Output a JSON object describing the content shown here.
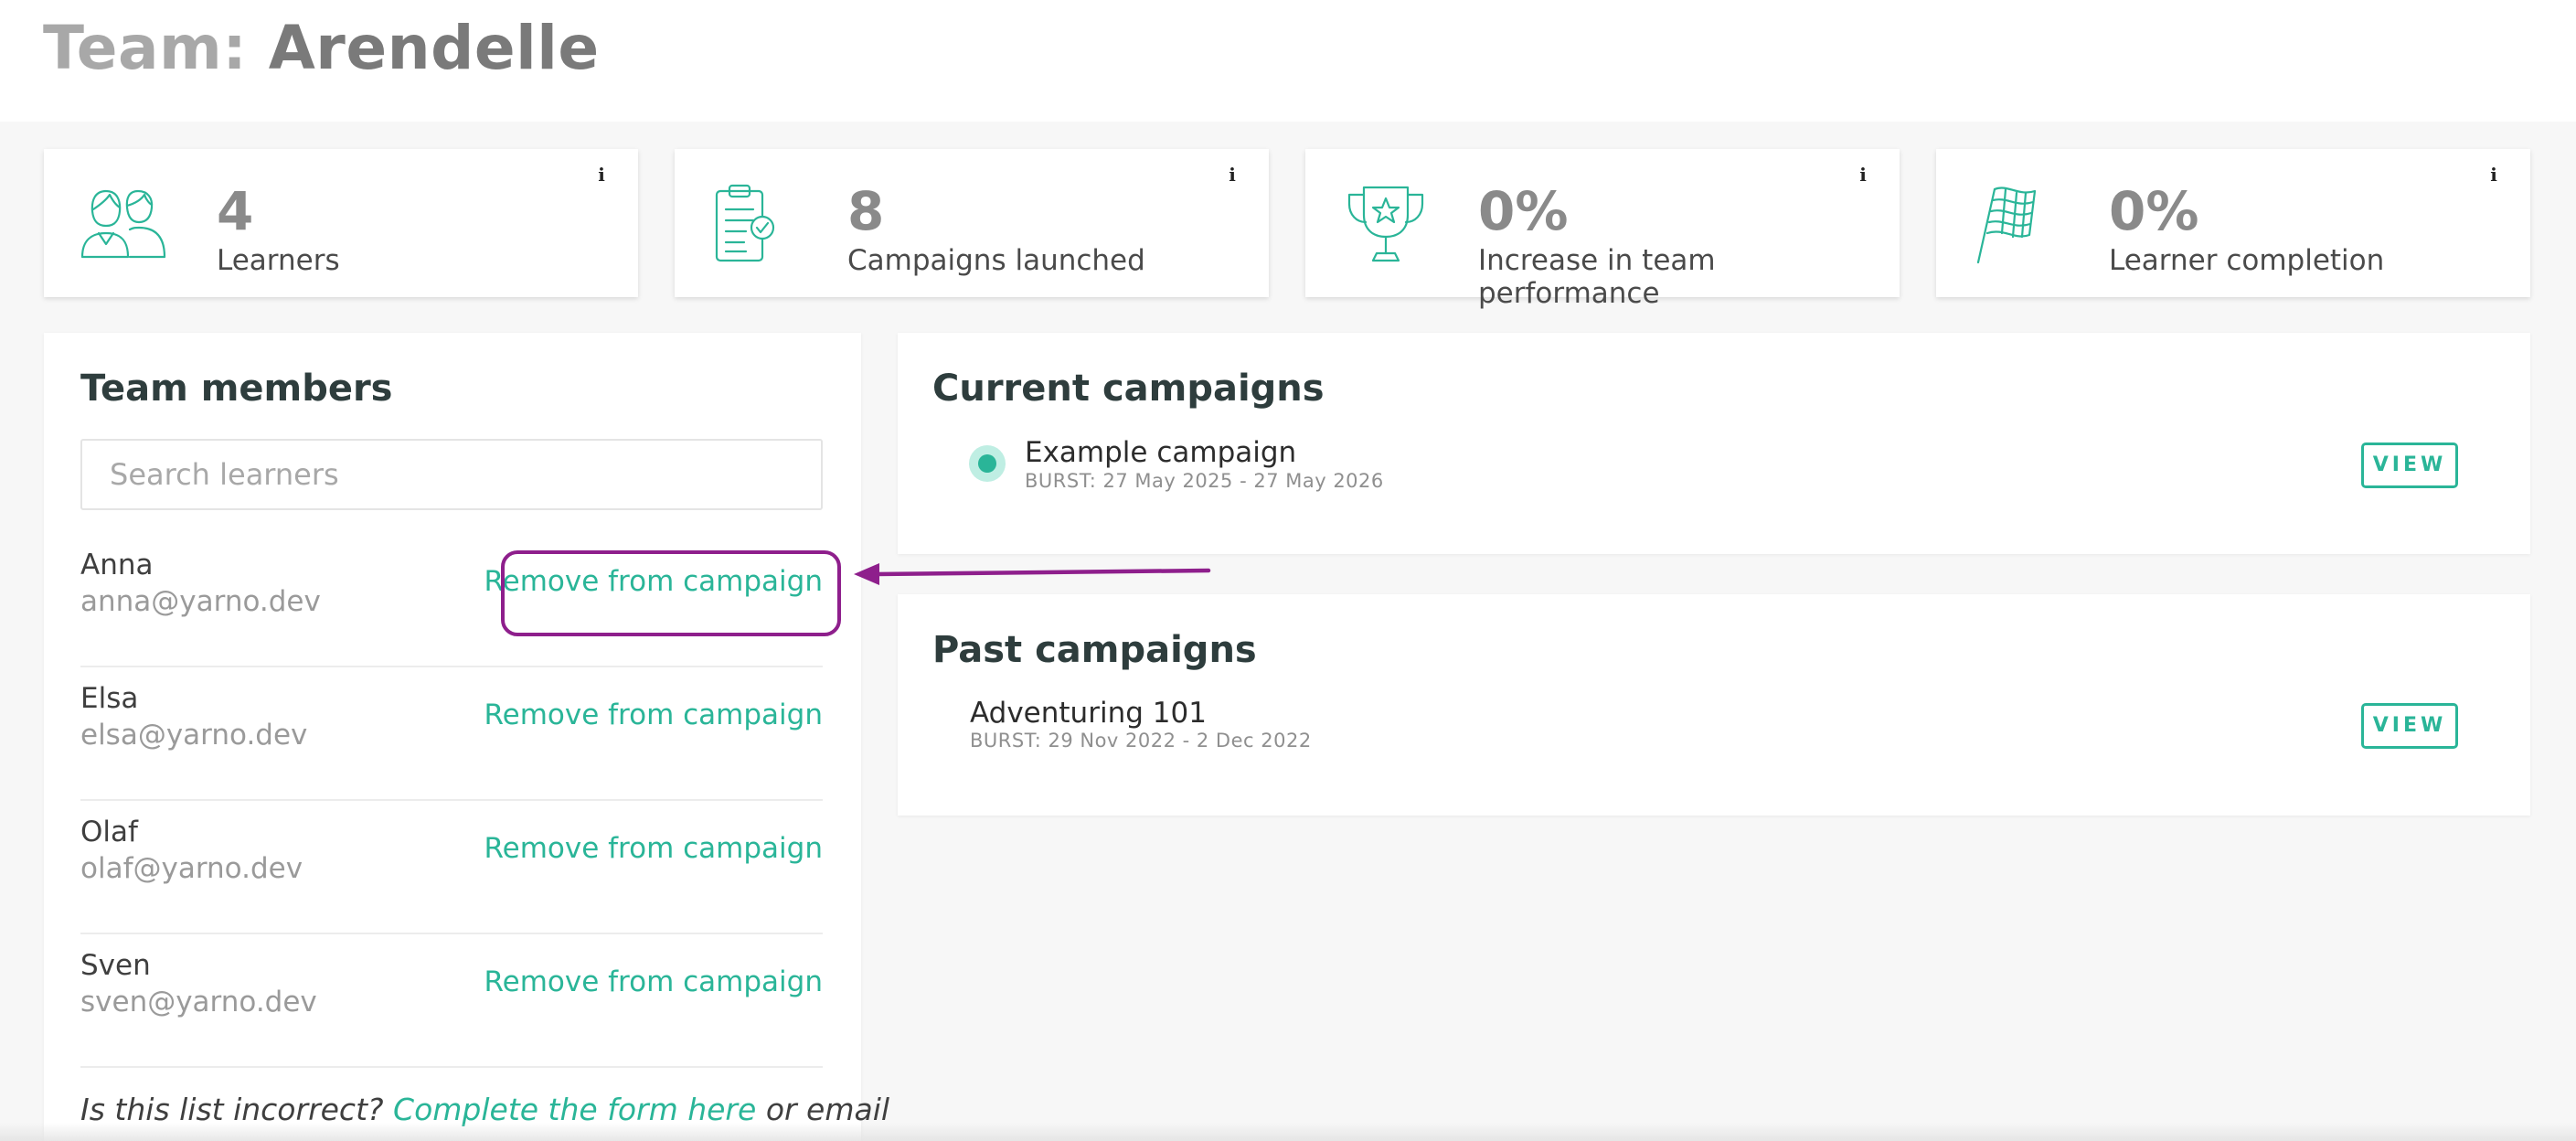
{
  "header": {
    "title_prefix": "Team:",
    "team_name": "Arendelle"
  },
  "stats": [
    {
      "icon": "learners-icon",
      "value": "4",
      "label": "Learners"
    },
    {
      "icon": "clipboard-check-icon",
      "value": "8",
      "label": "Campaigns launched"
    },
    {
      "icon": "trophy-icon",
      "value": "0%",
      "label": "Increase in team performance"
    },
    {
      "icon": "checkered-flag-icon",
      "value": "0%",
      "label": "Learner completion"
    }
  ],
  "team_members": {
    "title": "Team members",
    "search_placeholder": "Search learners",
    "remove_label": "Remove from campaign",
    "members": [
      {
        "name": "Anna",
        "email": "anna@yarno.dev"
      },
      {
        "name": "Elsa",
        "email": "elsa@yarno.dev"
      },
      {
        "name": "Olaf",
        "email": "olaf@yarno.dev"
      },
      {
        "name": "Sven",
        "email": "sven@yarno.dev"
      }
    ],
    "footer": {
      "prefix": "Is this list incorrect?",
      "link": "Complete the form here",
      "suffix": "or email"
    }
  },
  "current_campaigns": {
    "title": "Current campaigns",
    "items": [
      {
        "name": "Example campaign",
        "meta": "BURST: 27 May 2025 - 27 May 2026",
        "action": "VIEW"
      }
    ]
  },
  "past_campaigns": {
    "title": "Past campaigns",
    "items": [
      {
        "name": "Adventuring 101",
        "meta": "BURST: 29 Nov 2022 - 2 Dec 2022",
        "action": "VIEW"
      }
    ]
  },
  "colors": {
    "accent": "#2ab598",
    "annotation": "#8e1f8c",
    "title_gray": "#a8a8a8",
    "background": "#f7f7f7"
  }
}
